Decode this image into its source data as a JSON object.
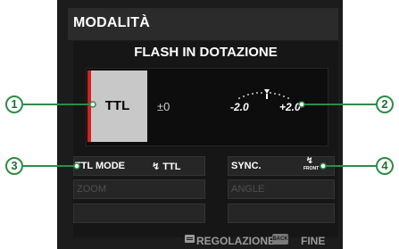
{
  "header": {
    "mode_title": "MODALITÀ",
    "sub_title": "FLASH IN DOTAZIONE"
  },
  "flash_panel": {
    "mode_label": "TTL",
    "compensation": "±0",
    "scale_min": "-2.0",
    "scale_max": "+2.0",
    "accent_color": "#d42020"
  },
  "settings": {
    "ttl_mode_label": "TTL MODE",
    "ttl_mode_value": "↯ TTL",
    "sync_label": "SYNC.",
    "sync_value": "FRONT",
    "zoom_label": "ZOOM",
    "angle_label": "ANGLE"
  },
  "footer": {
    "adjust_label": "REGOLAZIONE",
    "back_badge": "BACK",
    "end_label": "FINE"
  },
  "callouts": [
    "1",
    "2",
    "3",
    "4"
  ],
  "callout_color": "#2e8c47"
}
